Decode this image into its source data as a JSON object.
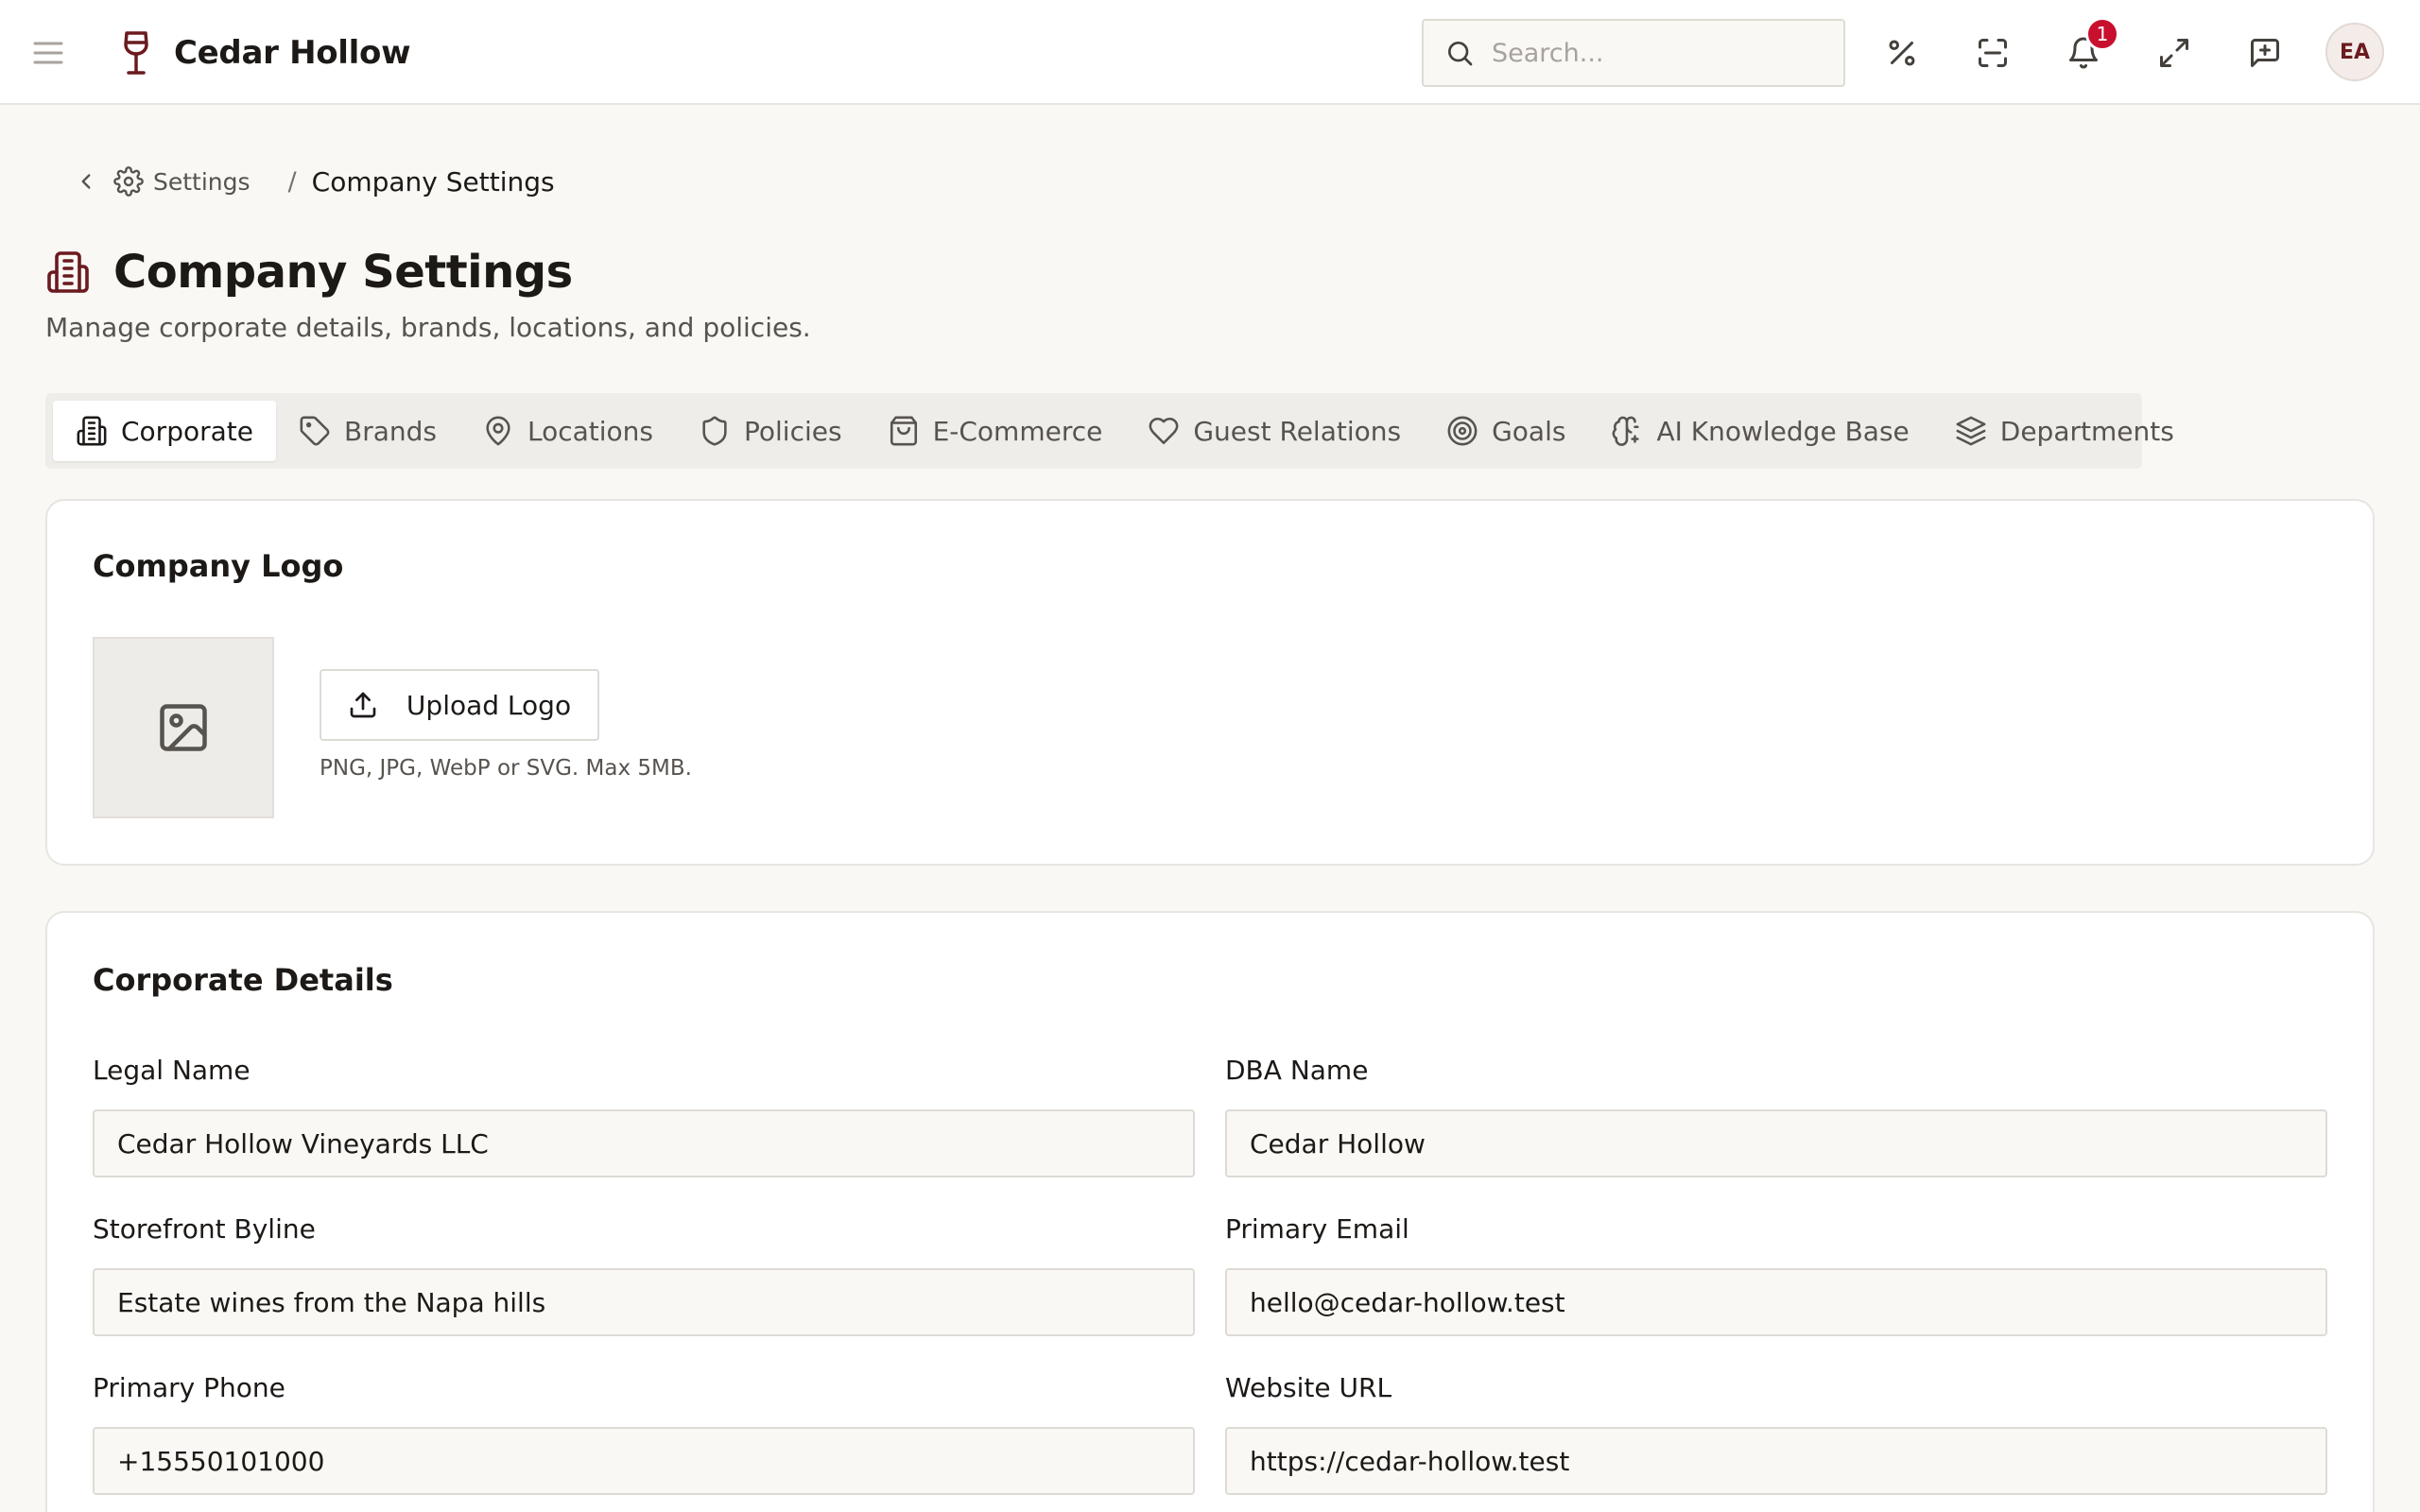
{
  "app": {
    "name": "Cedar Hollow",
    "brand_color": "#6b1a1f"
  },
  "header": {
    "search_placeholder": "Search...",
    "notifications_count": "1",
    "avatar_initials": "EA",
    "icons": [
      "menu-icon",
      "wine-glass-icon",
      "search-icon",
      "percent-icon",
      "scan-icon",
      "bell-icon",
      "expand-icon",
      "message-plus-icon"
    ]
  },
  "breadcrumb": {
    "parent": "Settings",
    "separator": "/",
    "current": "Company Settings"
  },
  "page": {
    "title": "Company Settings",
    "subtitle": "Manage corporate details, brands, locations, and policies."
  },
  "tabs": [
    {
      "label": "Corporate",
      "icon": "building-icon",
      "active": true
    },
    {
      "label": "Brands",
      "icon": "tag-icon",
      "active": false
    },
    {
      "label": "Locations",
      "icon": "map-pin-icon",
      "active": false
    },
    {
      "label": "Policies",
      "icon": "shield-icon",
      "active": false
    },
    {
      "label": "E-Commerce",
      "icon": "shopping-bag-icon",
      "active": false
    },
    {
      "label": "Guest Relations",
      "icon": "heart-icon",
      "active": false
    },
    {
      "label": "Goals",
      "icon": "target-icon",
      "active": false
    },
    {
      "label": "AI Knowledge Base",
      "icon": "brain-icon",
      "active": false
    },
    {
      "label": "Departments",
      "icon": "layers-icon",
      "active": false
    }
  ],
  "logo_card": {
    "title": "Company Logo",
    "upload_label": "Upload Logo",
    "hint": "PNG, JPG, WebP or SVG. Max 5MB."
  },
  "details_card": {
    "title": "Corporate Details",
    "fields": [
      {
        "label": "Legal Name",
        "value": "Cedar Hollow Vineyards LLC"
      },
      {
        "label": "DBA Name",
        "value": "Cedar Hollow"
      },
      {
        "label": "Storefront Byline",
        "value": "Estate wines from the Napa hills"
      },
      {
        "label": "Primary Email",
        "value": "hello@cedar-hollow.test"
      },
      {
        "label": "Primary Phone",
        "value": "+15550101000"
      },
      {
        "label": "Website URL",
        "value": "https://cedar-hollow.test"
      }
    ]
  }
}
